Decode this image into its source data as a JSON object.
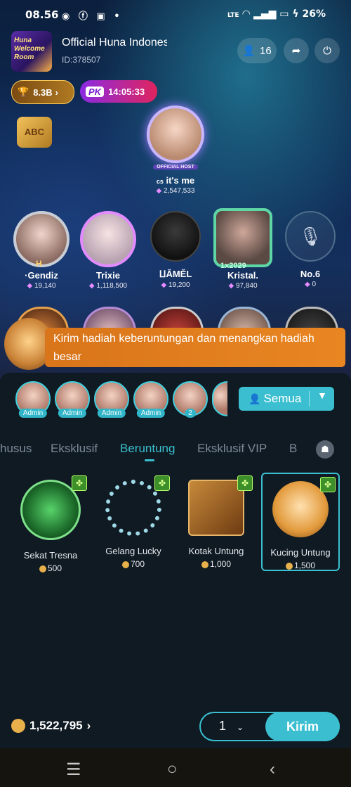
{
  "status_bar": {
    "time": "08.56",
    "battery": "26%",
    "network": "LTE"
  },
  "room": {
    "thumb_text": "Huna Welcome Room",
    "name": "Official Huna Indonesia",
    "id": "ID:378507",
    "viewer_count": "16"
  },
  "pills": {
    "trophy": "8.3B",
    "pk_label": "PK",
    "pk_timer": "14:05:33"
  },
  "host": {
    "badge": "OFFICIAL HOST",
    "name": "it's me",
    "prefix": "cs",
    "score": "2,547,533"
  },
  "seats": [
    {
      "name": "·Gendiz",
      "score": "19,140",
      "frame": "H"
    },
    {
      "name": "Trixie",
      "score": "1,118,500",
      "frame": ""
    },
    {
      "name": "ⵡĂMĔL",
      "score": "19,200",
      "frame": ""
    },
    {
      "name": "Kristal.",
      "score": "97,840",
      "frame": "1x2029"
    },
    {
      "name": "No.6",
      "score": "0",
      "frame": ""
    }
  ],
  "banner": {
    "text": "Kirim hadiah keberuntungan dan menangkan hadiah besar"
  },
  "viewers": [
    {
      "tag": "Admin"
    },
    {
      "tag": "Admin"
    },
    {
      "tag": "Admin"
    },
    {
      "tag": "Admin"
    },
    {
      "tag": "2"
    }
  ],
  "filter": {
    "label": "Semua"
  },
  "tabs": [
    "husus",
    "Eksklusif",
    "Beruntung",
    "Eksklusif VIP",
    "B"
  ],
  "active_tab": "Beruntung",
  "gifts": [
    {
      "name": "Sekat Tresna",
      "price": "500"
    },
    {
      "name": "Gelang Lucky",
      "price": "700"
    },
    {
      "name": "Kotak Untung",
      "price": "1,000"
    },
    {
      "name": "Kucing Untung",
      "price": "1,500"
    }
  ],
  "balance": "1,522,795",
  "send": {
    "quantity": "1",
    "label": "Kirim"
  },
  "colors": {
    "accent": "#3bbfd0",
    "banner": "#e98622",
    "panel": "#0f1a22"
  }
}
